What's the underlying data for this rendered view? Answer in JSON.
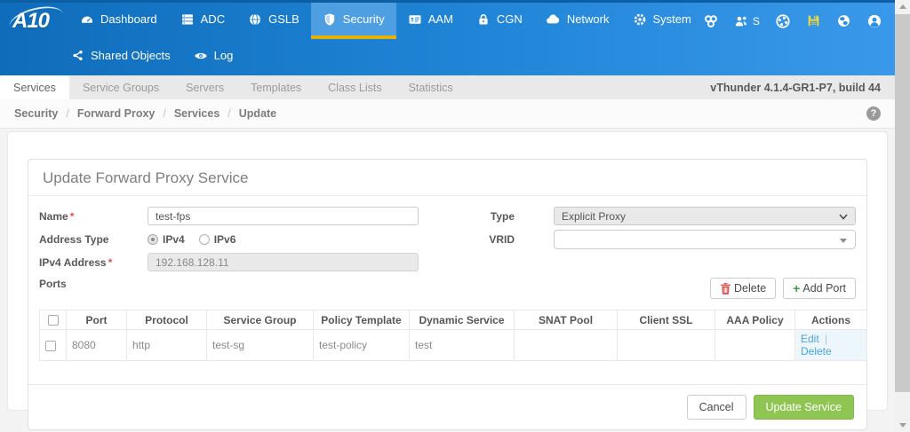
{
  "header": {
    "logo_text": "A10",
    "nav": [
      {
        "label": "Dashboard"
      },
      {
        "label": "ADC"
      },
      {
        "label": "GSLB"
      },
      {
        "label": "Security"
      },
      {
        "label": "AAM"
      },
      {
        "label": "CGN"
      },
      {
        "label": "Network"
      },
      {
        "label": "System"
      }
    ],
    "partition_label": "S",
    "subnav": [
      {
        "label": "Shared Objects"
      },
      {
        "label": "Log"
      }
    ]
  },
  "tabs": {
    "items": [
      "Services",
      "Service Groups",
      "Servers",
      "Templates",
      "Class Lists",
      "Statistics"
    ],
    "version": "vThunder 4.1.4-GR1-P7, build 44"
  },
  "breadcrumb": {
    "items": [
      "Security",
      "Forward Proxy",
      "Services",
      "Update"
    ],
    "separator": "/",
    "help_glyph": "?"
  },
  "form": {
    "title": "Update Forward Proxy Service",
    "required_marker": "*",
    "fields": {
      "name": {
        "label": "Name",
        "value": "test-fps"
      },
      "type": {
        "label": "Type",
        "value": "Explicit Proxy"
      },
      "address_type": {
        "label": "Address Type",
        "options": [
          "IPv4",
          "IPv6"
        ],
        "selected": "IPv4"
      },
      "vrid": {
        "label": "VRID",
        "value": ""
      },
      "ipv4_address": {
        "label": "IPv4 Address",
        "value": "192.168.128.11"
      },
      "ports_label": "Ports"
    },
    "toolbar": {
      "delete_label": "Delete",
      "add_plus": "+",
      "add_port_label": "Add Port"
    },
    "table": {
      "columns": [
        "Port",
        "Protocol",
        "Service Group",
        "Policy Template",
        "Dynamic Service",
        "SNAT Pool",
        "Client SSL",
        "AAA Policy",
        "Actions"
      ],
      "rows": [
        {
          "port": "8080",
          "protocol": "http",
          "service_group": "test-sg",
          "policy_template": "test-policy",
          "dynamic_service": "test",
          "snat_pool": "",
          "client_ssl": "",
          "aaa_policy": ""
        }
      ],
      "actions": {
        "edit_label": "Edit",
        "separator": "|",
        "delete_label": "Delete"
      }
    },
    "footer": {
      "cancel_label": "Cancel",
      "submit_label": "Update Service"
    }
  },
  "colors": {
    "header_blue": "#1878c9",
    "accent_yellow": "#e8b000",
    "green_button": "#8fc653",
    "link_blue": "#4ba3dd",
    "danger_red": "#d9534f"
  }
}
